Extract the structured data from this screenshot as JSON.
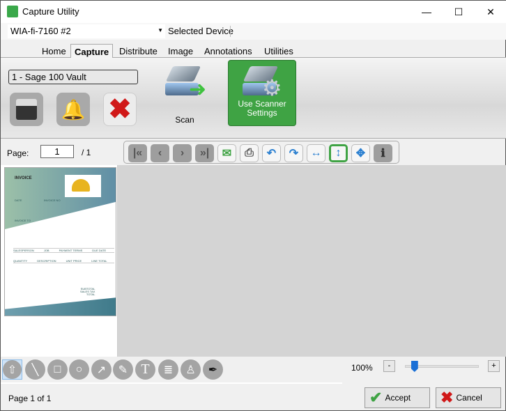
{
  "window": {
    "title": "Capture Utility",
    "minimize": "—",
    "maximize": "☐",
    "close": "✕"
  },
  "device": {
    "selected": "WIA-fi-7160 #2",
    "label": "Selected Device"
  },
  "tabs": [
    "Home",
    "Capture",
    "Distribute",
    "Image",
    "Annotations",
    "Utilities"
  ],
  "active_tab": "Capture",
  "ribbon": {
    "vault": "1 - Sage 100 Vault",
    "scan_label": "Scan",
    "scanner_settings_label": "Use Scanner Settings"
  },
  "pager": {
    "label": "Page:",
    "current": "1",
    "total": "/ 1"
  },
  "thumbnail": {
    "title": "INVOICE",
    "labels": [
      "DATE",
      "INVOICE NO",
      "INVOICE TO"
    ],
    "table_headers": [
      "SALESPERSON",
      "JOB",
      "PAYMENT TERMS",
      "DUE DATE"
    ],
    "line_headers": [
      "QUANTITY",
      "DESCRIPTION",
      "UNIT PRICE",
      "LINE TOTAL"
    ],
    "totals": [
      "SUBTOTAL",
      "SALES TAX",
      "TOTAL"
    ]
  },
  "zoom": {
    "percent": "100%",
    "minus": "-",
    "plus": "+",
    "level": 0.13
  },
  "status": "Page 1 of 1",
  "footer": {
    "accept": "Accept",
    "cancel": "Cancel"
  },
  "colors": {
    "accent_green": "#3fa344",
    "slider_blue": "#1a6fd6"
  }
}
